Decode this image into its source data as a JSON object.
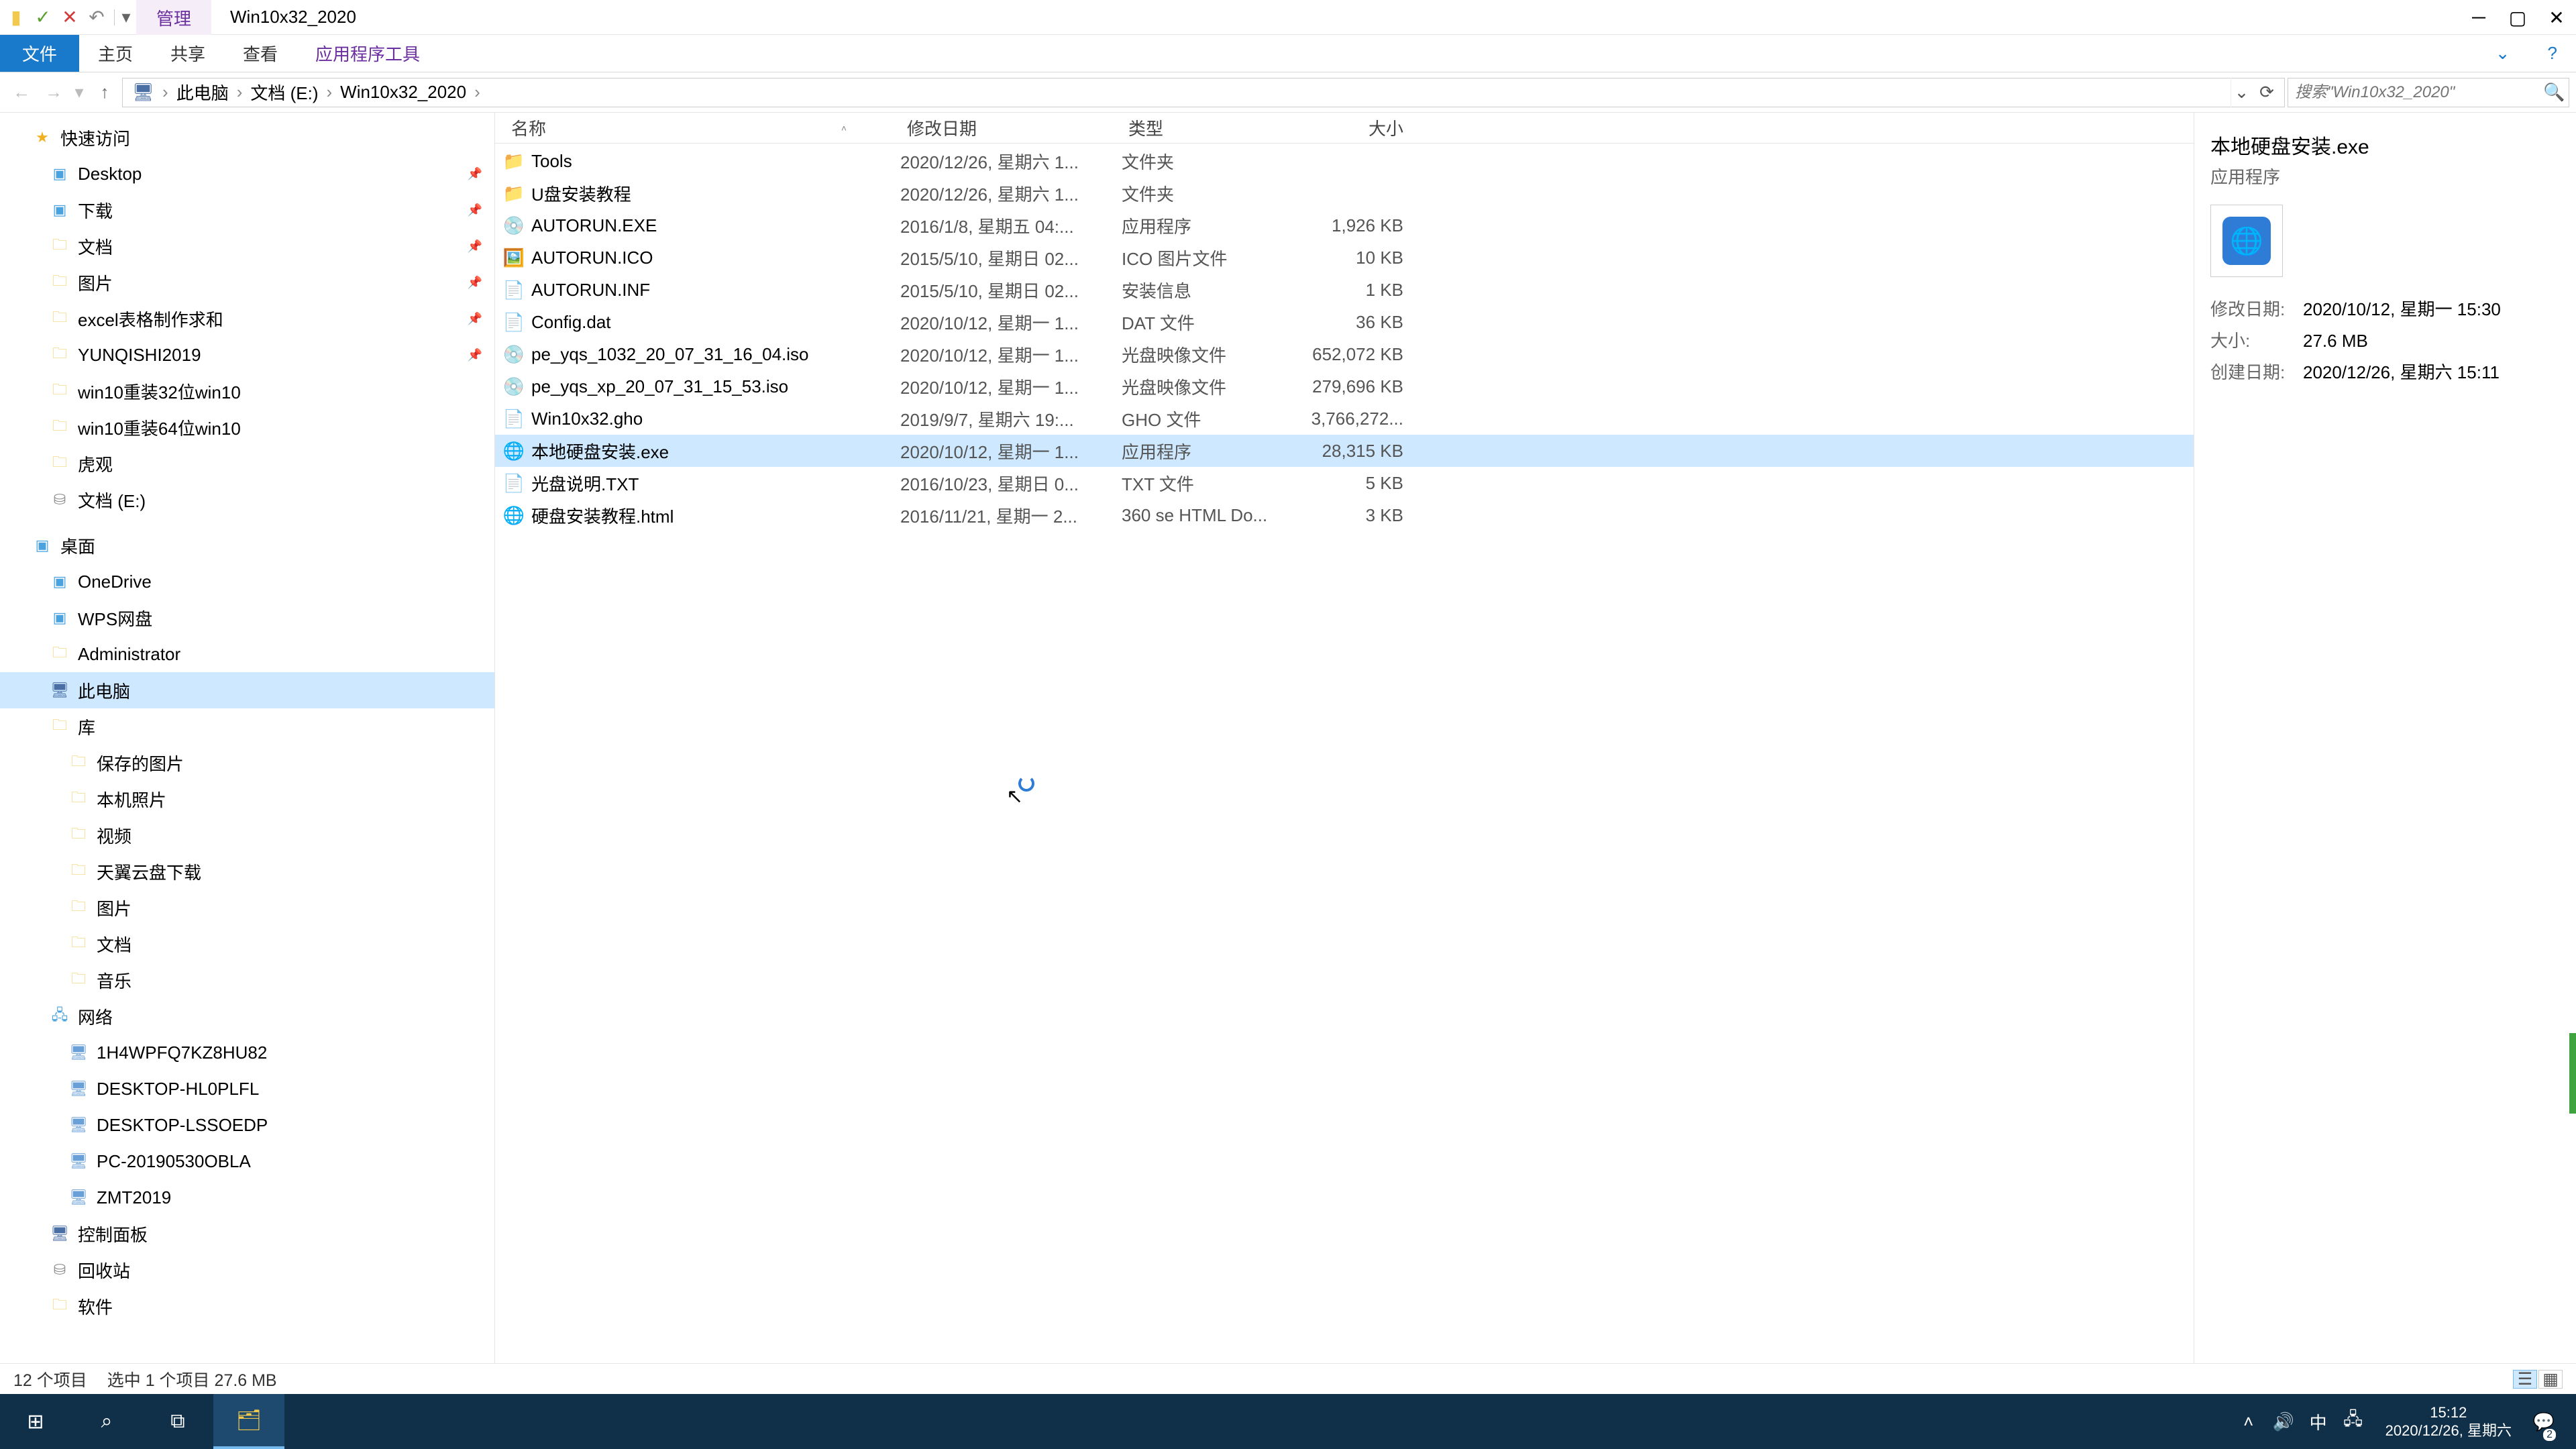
{
  "title": "Win10x32_2020",
  "ribbon": {
    "context_tab": "管理",
    "file": "文件",
    "tabs": [
      "主页",
      "共享",
      "查看"
    ],
    "context_tool": "应用程序工具"
  },
  "breadcrumb": [
    "此电脑",
    "文档 (E:)",
    "Win10x32_2020"
  ],
  "search_placeholder": "搜索\"Win10x32_2020\"",
  "columns": {
    "name": "名称",
    "date": "修改日期",
    "type": "类型",
    "size": "大小"
  },
  "nav": {
    "quick": "快速访问",
    "quick_items": [
      {
        "label": "Desktop",
        "icon": "ic-blue",
        "pin": true
      },
      {
        "label": "下载",
        "icon": "ic-blue",
        "pin": true
      },
      {
        "label": "文档",
        "icon": "ic-folder",
        "pin": true
      },
      {
        "label": "图片",
        "icon": "ic-folder",
        "pin": true
      },
      {
        "label": "excel表格制作求和",
        "icon": "ic-folder",
        "pin": true
      },
      {
        "label": "YUNQISHI2019",
        "icon": "ic-folder",
        "pin": true
      },
      {
        "label": "win10重装32位win10",
        "icon": "ic-folder"
      },
      {
        "label": "win10重装64位win10",
        "icon": "ic-folder"
      },
      {
        "label": "虎观",
        "icon": "ic-folder"
      },
      {
        "label": "文档 (E:)",
        "icon": "ic-disk"
      }
    ],
    "desktop": "桌面",
    "desktop_items": [
      {
        "label": "OneDrive",
        "icon": "ic-blue"
      },
      {
        "label": "WPS网盘",
        "icon": "ic-blue"
      },
      {
        "label": "Administrator",
        "icon": "ic-folder"
      },
      {
        "label": "此电脑",
        "icon": "ic-pc",
        "selected": true
      },
      {
        "label": "库",
        "icon": "ic-folder"
      }
    ],
    "lib_items": [
      {
        "label": "保存的图片",
        "icon": "ic-folder"
      },
      {
        "label": "本机照片",
        "icon": "ic-folder"
      },
      {
        "label": "视频",
        "icon": "ic-folder"
      },
      {
        "label": "天翼云盘下载",
        "icon": "ic-folder"
      },
      {
        "label": "图片",
        "icon": "ic-folder"
      },
      {
        "label": "文档",
        "icon": "ic-folder"
      },
      {
        "label": "音乐",
        "icon": "ic-folder"
      }
    ],
    "network": "网络",
    "net_items": [
      {
        "label": "1H4WPFQ7KZ8HU82",
        "icon": "ic-hdd"
      },
      {
        "label": "DESKTOP-HL0PLFL",
        "icon": "ic-hdd"
      },
      {
        "label": "DESKTOP-LSSOEDP",
        "icon": "ic-hdd"
      },
      {
        "label": "PC-20190530OBLA",
        "icon": "ic-hdd"
      },
      {
        "label": "ZMT2019",
        "icon": "ic-hdd"
      }
    ],
    "bottom": [
      {
        "label": "控制面板",
        "icon": "ic-pc"
      },
      {
        "label": "回收站",
        "icon": "ic-disk"
      },
      {
        "label": "软件",
        "icon": "ic-folder"
      }
    ]
  },
  "files": [
    {
      "name": "Tools",
      "date": "2020/12/26, 星期六 1...",
      "type": "文件夹",
      "size": "",
      "ic": "📁",
      "sel": false
    },
    {
      "name": "U盘安装教程",
      "date": "2020/12/26, 星期六 1...",
      "type": "文件夹",
      "size": "",
      "ic": "📁",
      "sel": false
    },
    {
      "name": "AUTORUN.EXE",
      "date": "2016/1/8, 星期五 04:...",
      "type": "应用程序",
      "size": "1,926 KB",
      "ic": "💿",
      "sel": false
    },
    {
      "name": "AUTORUN.ICO",
      "date": "2015/5/10, 星期日 02...",
      "type": "ICO 图片文件",
      "size": "10 KB",
      "ic": "🖼️",
      "sel": false
    },
    {
      "name": "AUTORUN.INF",
      "date": "2015/5/10, 星期日 02...",
      "type": "安装信息",
      "size": "1 KB",
      "ic": "📄",
      "sel": false
    },
    {
      "name": "Config.dat",
      "date": "2020/10/12, 星期一 1...",
      "type": "DAT 文件",
      "size": "36 KB",
      "ic": "📄",
      "sel": false
    },
    {
      "name": "pe_yqs_1032_20_07_31_16_04.iso",
      "date": "2020/10/12, 星期一 1...",
      "type": "光盘映像文件",
      "size": "652,072 KB",
      "ic": "💿",
      "sel": false
    },
    {
      "name": "pe_yqs_xp_20_07_31_15_53.iso",
      "date": "2020/10/12, 星期一 1...",
      "type": "光盘映像文件",
      "size": "279,696 KB",
      "ic": "💿",
      "sel": false
    },
    {
      "name": "Win10x32.gho",
      "date": "2019/9/7, 星期六 19:...",
      "type": "GHO 文件",
      "size": "3,766,272...",
      "ic": "📄",
      "sel": false
    },
    {
      "name": "本地硬盘安装.exe",
      "date": "2020/10/12, 星期一 1...",
      "type": "应用程序",
      "size": "28,315 KB",
      "ic": "🌐",
      "sel": true
    },
    {
      "name": "光盘说明.TXT",
      "date": "2016/10/23, 星期日 0...",
      "type": "TXT 文件",
      "size": "5 KB",
      "ic": "📄",
      "sel": false
    },
    {
      "name": "硬盘安装教程.html",
      "date": "2016/11/21, 星期一 2...",
      "type": "360 se HTML Do...",
      "size": "3 KB",
      "ic": "🌐",
      "sel": false
    }
  ],
  "preview": {
    "title": "本地硬盘安装.exe",
    "subtitle": "应用程序",
    "meta": [
      {
        "k": "修改日期:",
        "v": "2020/10/12, 星期一 15:30"
      },
      {
        "k": "大小:",
        "v": "27.6 MB"
      },
      {
        "k": "创建日期:",
        "v": "2020/12/26, 星期六 15:11"
      }
    ]
  },
  "status": {
    "count": "12 个项目",
    "sel": "选中 1 个项目  27.6 MB"
  },
  "taskbar": {
    "time": "15:12",
    "date": "2020/12/26, 星期六",
    "ime": "中",
    "badge": "2"
  }
}
